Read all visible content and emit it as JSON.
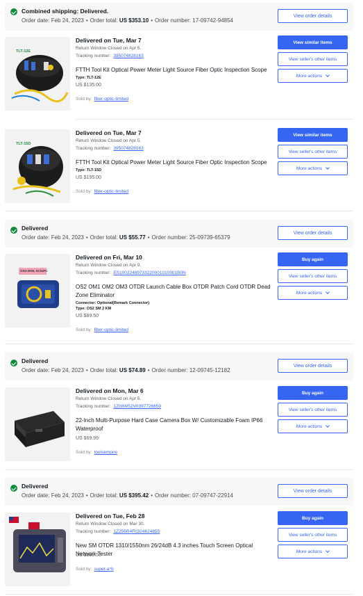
{
  "common": {
    "order_date_label": "Order date:",
    "order_total_label": "Order total:",
    "order_number_label": "Order number:",
    "return_window_prefix": "Return Window Closed on",
    "tracking_label": "Tracking number:",
    "sold_by_label": "Sold by:",
    "view_order_details": "View order details",
    "view_similar_items": "View similar items",
    "view_sellers_other_items": "View seller's other items",
    "more_actions": "More actions",
    "buy_again": "Buy again"
  },
  "orders": [
    {
      "status": "Combined shipping: Delivered.",
      "date": "Feb 24, 2023",
      "total": "US $353.10",
      "number": "17-09742-94854",
      "items": [
        {
          "thumb_label": "TLT-12E",
          "delivered": "Delivered on Tue, Mar 7",
          "return_date": "Apr 5.",
          "tracking": "395074828163",
          "name": "FTTH Tool Kit Optical Power Meter Light Source Fiber Optic Inspection Scope",
          "specs": [
            "Type: TLT-12E"
          ],
          "price": "US $135.00",
          "seller": "fiber-optic-limited"
        },
        {
          "thumb_label": "TLT-15D",
          "delivered": "Delivered on Tue, Mar 7",
          "return_date": "Apr 5.",
          "tracking": "395074828163",
          "name": "FTTH Tool Kit Optical Power Meter Light Source Fiber Optic Inspection Scope",
          "specs": [
            "Type: TLT-15D"
          ],
          "price": "US $195.00",
          "seller": "fiber-optic-limited"
        }
      ]
    },
    {
      "status": "Delivered",
      "date": "Feb 24, 2023",
      "total": "US $55.77",
      "number": "25-09739-65379",
      "items": [
        {
          "thumb_label": "OS2-2KM, SC/UPC",
          "delivered": "Delivered on Fri, Mar 10",
          "return_date": "Apr 9.",
          "tracking": "ES10022489733220001010001B0N",
          "name": "OS2 OM1 OM2 OM3 OTDR Launch Cable Box OTDR Patch Cord OTDR Dead Zone Eliminator",
          "specs": [
            "Connector: Optional(Remark Connector)",
            "Type: OS2 SM 2 KM"
          ],
          "price": "US $89.50",
          "seller": "fiber-optic-limited"
        }
      ]
    },
    {
      "status": "Delivered",
      "date": "Feb 24, 2023",
      "total": "US $74.89",
      "number": "12-09745-12182",
      "items": [
        {
          "thumb_label": "",
          "delivered": "Delivered on Mon, Mar 6",
          "return_date": "Apr 5.",
          "tracking": "1Z08W52V0397726659",
          "name": "22-Inch Multi-Purpose Hard Case Camera Box W/ Customizable Foam IP66 Waterproof",
          "specs": [],
          "price": "US $69.99",
          "seller": "toolsempire"
        }
      ]
    },
    {
      "status": "Delivered",
      "date": "Feb 24, 2023",
      "total": "US $395.42",
      "number": "07-09747-22914",
      "items": [
        {
          "thumb_label": "",
          "delivered": "Delivered on Tue, Feb 28",
          "return_date": "Mar 30.",
          "tracking": "1Z256R4F0324624855",
          "name": "New SM OTDR 1310/1550nm 26/24dB 4.3 inches Touch Screen Optical Network Tester",
          "specs": [],
          "price": "US $369.55",
          "seller": "super-a*b"
        }
      ]
    }
  ]
}
